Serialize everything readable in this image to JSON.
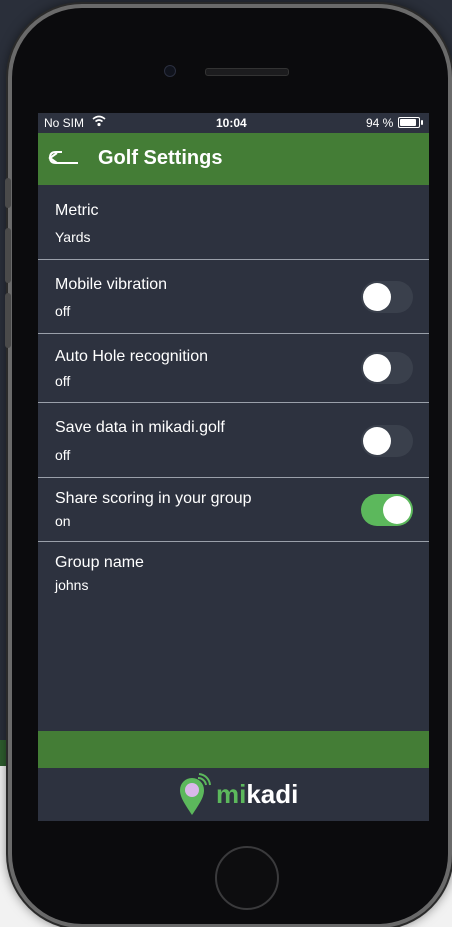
{
  "status_bar": {
    "carrier": "No SIM",
    "time": "10:04",
    "battery": "94 %",
    "battery_level": 0.94
  },
  "header": {
    "title": "Golf Settings"
  },
  "settings": [
    {
      "label": "Metric",
      "value": "Yards",
      "has_toggle": false
    },
    {
      "label": "Mobile vibration",
      "value": "off",
      "has_toggle": true,
      "toggle_on": false
    },
    {
      "label": "Auto Hole recognition",
      "value": "off",
      "has_toggle": true,
      "toggle_on": false
    },
    {
      "label": "Save data in mikadi.golf",
      "value": "off",
      "has_toggle": true,
      "toggle_on": false
    },
    {
      "label": "Share scoring in your group",
      "value": "on",
      "has_toggle": true,
      "toggle_on": true
    },
    {
      "label": "Group name",
      "value": "johns",
      "has_toggle": false
    }
  ],
  "logo": {
    "part1": "mi",
    "part2": "kadi"
  },
  "colors": {
    "header_green": "#447d36",
    "toggle_on": "#5cb85c",
    "background": "#2d323f"
  }
}
